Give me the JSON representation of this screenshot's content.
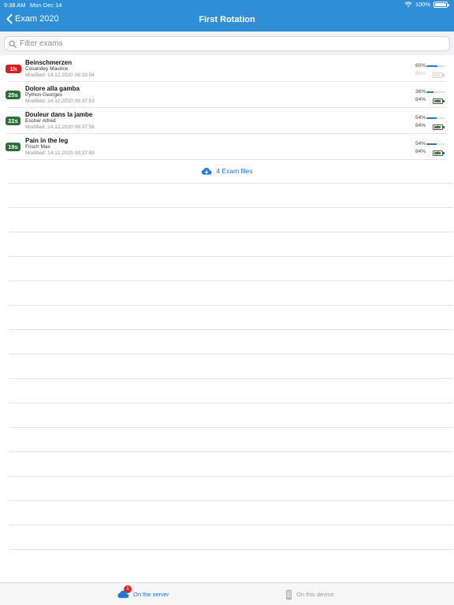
{
  "status_bar": {
    "time": "9:38 AM",
    "date": "Mon Dec 14",
    "battery": "100%"
  },
  "nav": {
    "back_label": "Exam 2020",
    "title": "First Rotation"
  },
  "search": {
    "placeholder": "Filter exams",
    "value": ""
  },
  "exams": [
    {
      "badge": "1h",
      "badge_color": "#d81f1f",
      "title": "Beinschmerzen",
      "author": "Cosandey Maurice",
      "modified": "Modified: 14.12.2020 08:33:54",
      "progress_pct": "60%",
      "progress": 0.6,
      "battery_pct": "85%",
      "battery": 0.85,
      "battery_faded": true
    },
    {
      "badge": "25s",
      "badge_color": "#2c6e35",
      "title": "Dolore alla gamba",
      "author": "Python Georges",
      "modified": "Modified: 14.12.2020 09:37:53",
      "progress_pct": "36%",
      "progress": 0.36,
      "battery_pct": "84%",
      "battery": 0.84,
      "battery_faded": false
    },
    {
      "badge": "22s",
      "badge_color": "#2c6e35",
      "title": "Douleur dans la jambe",
      "author": "Escher Alfred",
      "modified": "Modified: 14.12.2020 09:37:56",
      "progress_pct": "54%",
      "progress": 0.54,
      "battery_pct": "84%",
      "battery": 0.84,
      "battery_faded": false
    },
    {
      "badge": "19s",
      "badge_color": "#2c6e35",
      "title": "Pain in the leg",
      "author": "Frisch Max",
      "modified": "Modified: 14.12.2020 09:37:59",
      "progress_pct": "54%",
      "progress": 0.54,
      "battery_pct": "84%",
      "battery": 0.84,
      "battery_faded": false
    }
  ],
  "files_link": {
    "label": "4 Exam files"
  },
  "tabbar": {
    "server": {
      "label": "On the server",
      "badge": "1"
    },
    "device": {
      "label": "On this device"
    }
  },
  "colors": {
    "nav": "#2f8fd6",
    "accent": "#1e78d6",
    "danger": "#d81f1f",
    "success": "#2c6e35"
  }
}
